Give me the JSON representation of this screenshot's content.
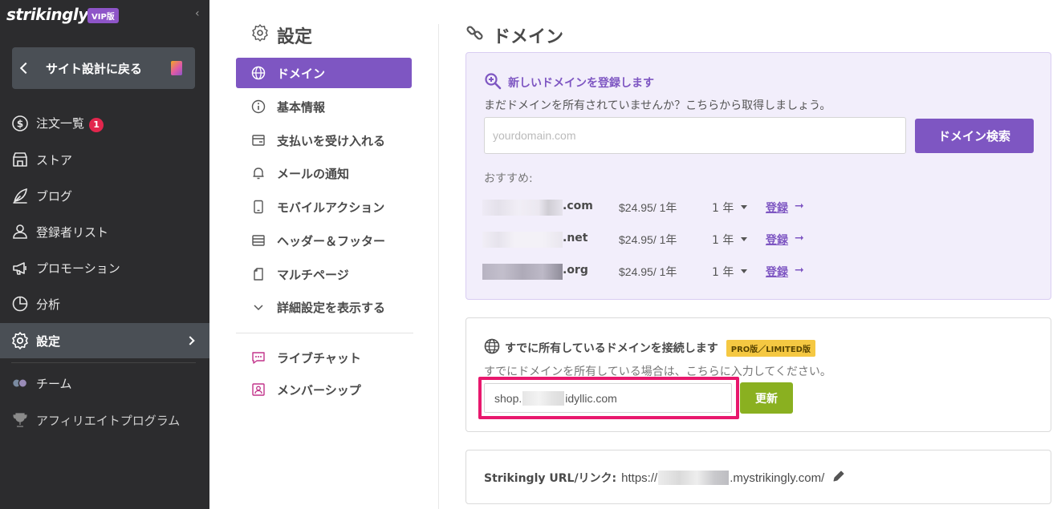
{
  "sidebar": {
    "logo": "strikingly",
    "vip_badge": "VIP版",
    "back_label": "サイト設計に戻る",
    "items": [
      {
        "label": "注文一覧",
        "badge": "1",
        "icon": "dollar-circle-icon"
      },
      {
        "label": "ストア",
        "icon": "store-icon"
      },
      {
        "label": "ブログ",
        "icon": "feather-pen-icon"
      },
      {
        "label": "登録者リスト",
        "icon": "users-icon"
      },
      {
        "label": "プロモーション",
        "icon": "megaphone-icon"
      },
      {
        "label": "分析",
        "icon": "pie-chart-icon"
      },
      {
        "label": "設定",
        "icon": "gear-icon",
        "active": true
      },
      {
        "label": "チーム",
        "icon": "avatars-icon"
      },
      {
        "label": "アフィリエイトプログラム",
        "icon": "trophy-icon"
      }
    ]
  },
  "settings_menu": {
    "title": "設定",
    "items": [
      {
        "label": "ドメイン",
        "icon": "globe-icon",
        "active": true
      },
      {
        "label": "基本情報",
        "icon": "info-icon"
      },
      {
        "label": "支払いを受け入れる",
        "icon": "card-icon"
      },
      {
        "label": "メールの通知",
        "icon": "bell-icon"
      },
      {
        "label": "モバイルアクション",
        "icon": "mobile-icon"
      },
      {
        "label": "ヘッダー＆フッター",
        "icon": "header-footer-icon"
      },
      {
        "label": "マルチページ",
        "icon": "pages-icon"
      },
      {
        "label": "詳細設定を表示する",
        "icon": "chevron-down-icon"
      }
    ],
    "extra_items": [
      {
        "label": "ライブチャット",
        "icon": "chat-icon"
      },
      {
        "label": "メンバーシップ",
        "icon": "member-card-icon"
      }
    ]
  },
  "domain_page": {
    "title": "ドメイン",
    "new_domain": {
      "title": "新しいドメインを登録します",
      "subtitle": "まだドメインを所有されていませんか？こちらから取得しましょう。",
      "placeholder": "yourdomain.com",
      "search_button": "ドメイン検索",
      "recommend_label": "おすすめ:",
      "suggestions": [
        {
          "tld": ".com",
          "price": "$24.95/ 1年",
          "term": "1 年",
          "register": "登録",
          "arrow": "➞"
        },
        {
          "tld": ".net",
          "price": "$24.95/ 1年",
          "term": "1 年",
          "register": "登録",
          "arrow": "➞"
        },
        {
          "tld": ".org",
          "price": "$24.95/ 1年",
          "term": "1 年",
          "register": "登録",
          "arrow": "➞"
        }
      ]
    },
    "connect": {
      "title": "すでに所有しているドメインを接続します",
      "badge": "PRO版／LIMITED版",
      "subtitle": "すでにドメインを所有している場合は、こちらに入力してください。",
      "value_prefix": "shop.",
      "value_suffix": "idyllic.com",
      "update_button": "更新"
    },
    "url": {
      "label": "Strikingly URL/リンク:",
      "prefix": "https://",
      "suffix": ".mystrikingly.com/"
    }
  },
  "colors": {
    "sidebar_bg": "#2c2c2e",
    "accent_purple": "#7e56c2",
    "update_green": "#8ab020",
    "highlight_pink": "#e8186d",
    "pro_badge_yellow": "#f5c842"
  }
}
